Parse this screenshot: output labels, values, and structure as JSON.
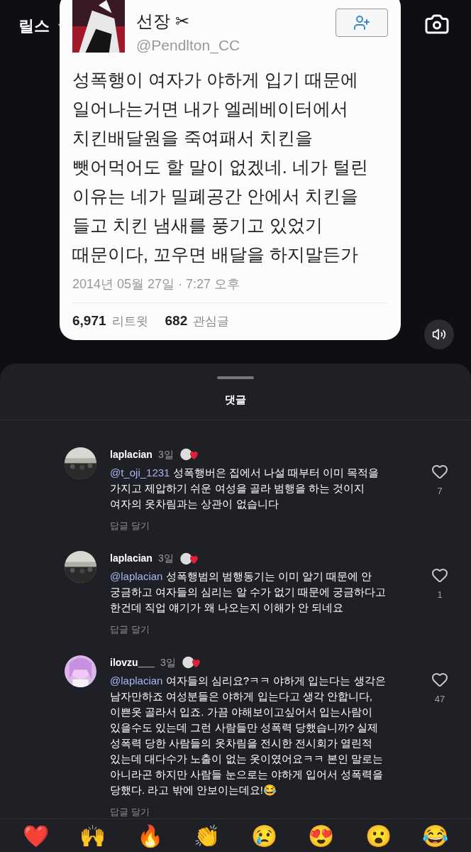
{
  "header": {
    "title": "릴스"
  },
  "tweet": {
    "name": "선장 ✂",
    "handle": "@Pendlton_CC",
    "lines": [
      "성폭행이 여자가 야하게 입기 때문에",
      "일어나는거면 내가 엘레베이터에서",
      "치킨배달원을 죽여패서 치킨을",
      "뺏어먹어도 할 말이 없겠네. 네가 털린",
      "이유는 네가 밀폐공간 안에서 치킨을",
      "들고 치킨 냄새를 풍기고 있었기",
      "때문이다, 꼬우면 배달을 하지말든가"
    ],
    "date": "2014년 05월 27일 · 7:27 오후",
    "stats": [
      {
        "count": "6,971",
        "label": "리트윗"
      },
      {
        "count": "682",
        "label": "관심글"
      }
    ]
  },
  "sheet": {
    "title": "댓글"
  },
  "comments": [
    {
      "user": "laplacian",
      "time": "3일",
      "mention": "@t_oji_1231",
      "lines": [
        "성폭행버은 집에서 나설 때부터 이미 목적을",
        "가지고 제압하기 쉬운 여성을 골라 범행을 하는 것이지",
        "여자의 옷차림과는 상관이 없습니다"
      ],
      "likes": "7",
      "reply": "답글 달기"
    },
    {
      "user": "laplacian",
      "time": "3일",
      "mention": "@laplacian",
      "lines": [
        "성폭행범의 범행동기는 이미 알기 때문에 안",
        "궁금하고 여자들의 심리는 알 수가 없기 때문에 궁금하다고",
        "한건데 직업 얘기가 왜 나오는지 이해가 안 되네요"
      ],
      "likes": "1",
      "reply": "답글 달기"
    },
    {
      "user": "ilovzu___",
      "time": "3일",
      "mention": "@laplacian",
      "lines": [
        "여자들의 심리요?ㅋㅋ 야하게 입는다는 생각은",
        "남자만하죠 여성분들은 야하게 입는다고 생각 안합니다,",
        "이쁜옷 골라서 입죠. 가끔 야해보이고싶어서 입는사람이",
        "있을수도 있는데 그런 사람들만 성폭력 당했습니까? 실제",
        "성폭력 당한 사람들의 옷차림을 전시한 전시회가 열린적",
        "있는데 대다수가 노출이 없는 옷이였어요ㅋㅋ 본인 말로는",
        "아니라곤 하지만 사람들 눈으로는 야하게 입어서 성폭력을",
        "당했다. 라고 밖에 안보이는데요!😂"
      ],
      "likes": "47",
      "reply": "답글 달기"
    }
  ],
  "reactions": [
    "❤️",
    "🙌",
    "🔥",
    "👏",
    "😢",
    "😍",
    "😮",
    "😂"
  ]
}
